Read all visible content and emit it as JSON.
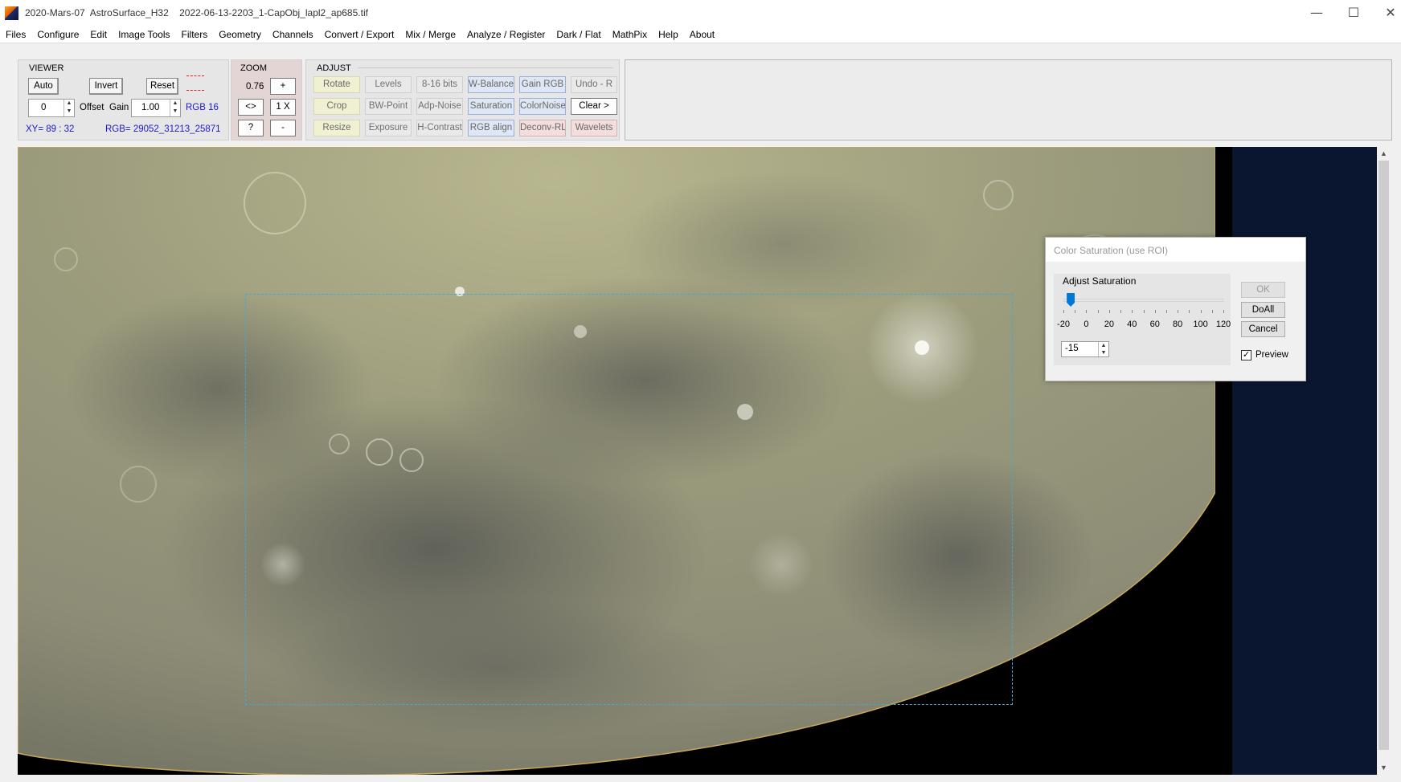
{
  "window": {
    "title": "2020-Mars-07  AstroSurface_H32    2022-06-13-2203_1-CapObj_lapl2_ap685.tif",
    "minimize_icon": "minimize-icon",
    "maximize_icon": "maximize-icon",
    "close_icon": "close-icon"
  },
  "menu": [
    "Files",
    "Configure",
    "Edit",
    "Image Tools",
    "Filters",
    "Geometry",
    "Channels",
    "Convert / Export",
    "Mix / Merge",
    "Analyze / Register",
    "Dark / Flat",
    "MathPix",
    "Help",
    "About"
  ],
  "viewer_panel": {
    "title": "VIEWER",
    "auto": "Auto",
    "invert": "Invert",
    "reset": "Reset",
    "offset_value": "0",
    "offset_label": "Offset",
    "gain_label": "Gain",
    "gain_value": "1.00",
    "rgb_depth": "RGB 16",
    "xy": "XY=  89 : 32",
    "rgb_values": "RGB=  29052_31213_25871"
  },
  "zoom_panel": {
    "title": "ZOOM",
    "value": "0.76",
    "plus": "+",
    "fit": "<>",
    "one_x": "1 X",
    "help": "?",
    "minus": "-"
  },
  "adjust_panel": {
    "title": "ADJUST",
    "row1": [
      "Rotate",
      "Levels",
      "8-16 bits",
      "W-Balance",
      "Gain RGB",
      "Undo - R"
    ],
    "row2": [
      "Crop",
      "BW-Point",
      "Adp-Noise",
      "Saturation",
      "ColorNoise",
      "Clear >"
    ],
    "row3": [
      "Resize",
      "Exposure",
      "H-Contrast",
      "RGB align",
      "Deconv-RL",
      "Wavelets"
    ]
  },
  "dialog": {
    "title": "Color Saturation (use ROI)",
    "group_label": "Adjust Saturation",
    "tick_labels": [
      "-20",
      "0",
      "20",
      "40",
      "60",
      "80",
      "100",
      "120"
    ],
    "slider": {
      "min": -20,
      "max": 120,
      "value": -15
    },
    "value_text": "-15",
    "ok": "OK",
    "doall": "DoAll",
    "cancel": "Cancel",
    "preview_label": "Preview",
    "preview_checked": "✓"
  },
  "colors": {
    "accent": "#0078d7",
    "roi_border": "#3fa9d8",
    "info_text": "#1a1acc"
  }
}
